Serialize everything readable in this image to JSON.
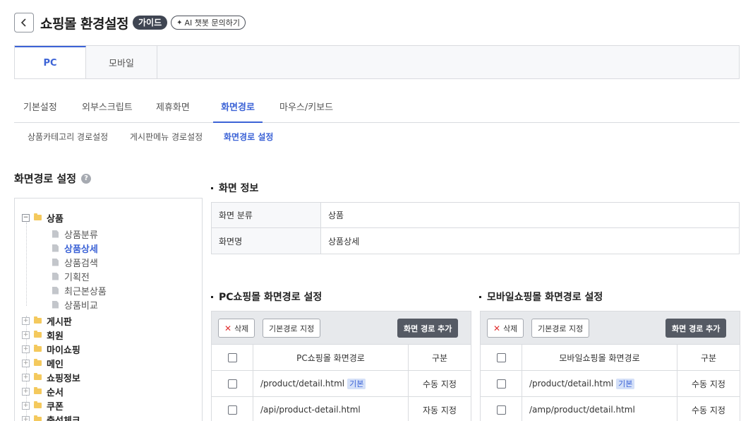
{
  "header": {
    "title": "쇼핑몰 환경설정",
    "guide_badge": "가이드",
    "ai_button": "AI 챗봇 문의하기"
  },
  "device_tabs": [
    {
      "label": "PC",
      "active": true
    },
    {
      "label": "모바일",
      "active": false
    }
  ],
  "main_tabs": [
    {
      "label": "기본설정"
    },
    {
      "label": "외부스크립트"
    },
    {
      "label": "제휴화면"
    },
    {
      "label": "화면경로",
      "active": true
    },
    {
      "label": "마우스/키보드"
    }
  ],
  "sub_tabs": [
    {
      "label": "상품카테고리 경로설정"
    },
    {
      "label": "게시판메뉴 경로설정"
    },
    {
      "label": "화면경로 설정",
      "active": true
    }
  ],
  "left": {
    "title": "화면경로 설정",
    "help": "?",
    "tree": {
      "root_label": "상품",
      "root_toggle": "−",
      "leaves": [
        "상품분류",
        "상품상세",
        "상품검색",
        "기획전",
        "최근본상품",
        "상품비교"
      ],
      "selected_leaf": "상품상세",
      "folders": [
        "게시판",
        "회원",
        "마이쇼핑",
        "메인",
        "쇼핑정보",
        "순서",
        "쿠폰",
        "출석체크"
      ],
      "folder_toggle": "+"
    }
  },
  "screen_info": {
    "title": "화면 정보",
    "rows": [
      {
        "label": "화면 분류",
        "value": "상품"
      },
      {
        "label": "화면명",
        "value": "상품상세"
      }
    ]
  },
  "pc_paths": {
    "title": "PC쇼핑몰 화면경로 설정",
    "delete_label": "삭제",
    "set_default_label": "기본경로 지정",
    "add_label": "화면 경로 추가",
    "col_path": "PC쇼핑몰 화면경로",
    "col_type": "구분",
    "rows": [
      {
        "path": "/product/detail.html",
        "tag": "기본",
        "type": "수동 지정"
      },
      {
        "path": "/api/product-detail.html",
        "tag": "",
        "type": "자동 지정"
      }
    ]
  },
  "mobile_paths": {
    "title": "모바일쇼핑몰 화면경로 설정",
    "delete_label": "삭제",
    "set_default_label": "기본경로 지정",
    "add_label": "화면 경로 추가",
    "col_path": "모바일쇼핑몰 화면경로",
    "col_type": "구분",
    "rows": [
      {
        "path": "/product/detail.html",
        "tag": "기본",
        "type": "수동 지정"
      },
      {
        "path": "/amp/product/detail.html",
        "tag": "",
        "type": "수동 지정"
      }
    ]
  },
  "colors": {
    "accent": "#3c63d6",
    "folder": "#f4c95d",
    "badge_dark": "#3f4552"
  }
}
